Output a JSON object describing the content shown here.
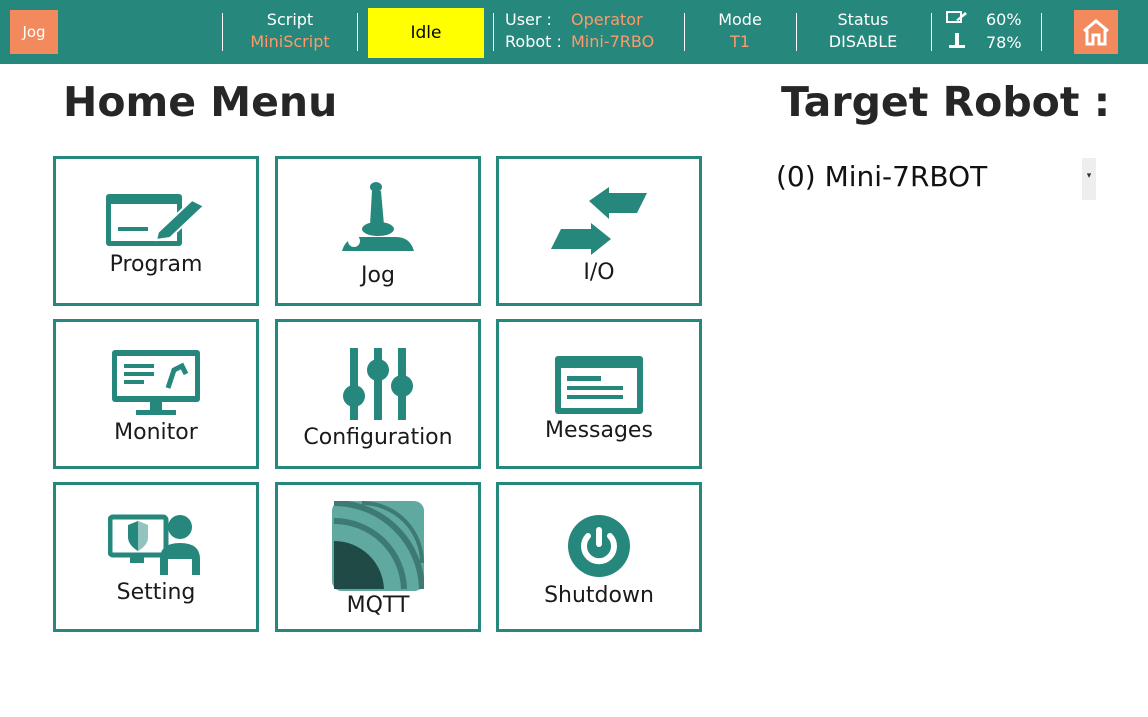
{
  "topbar": {
    "mode_button": "Jog",
    "script_label": "Script",
    "script_value": "MiniScript",
    "state": "Idle",
    "user_label": "User :",
    "user_value": "Operator",
    "robot_label": "Robot :",
    "robot_value": "Mini-7RBO",
    "mode_label": "Mode",
    "mode_value": "T1",
    "status_label": "Status",
    "status_value": "DISABLE",
    "speed_percent": "60%",
    "jog_percent": "78%",
    "home_icon": "home-icon"
  },
  "main": {
    "title": "Home Menu",
    "target_title": "Target Robot :",
    "target_value": "(0) Mini-7RBOT",
    "tiles": [
      {
        "label": "Program",
        "icon": "program-icon"
      },
      {
        "label": "Jog",
        "icon": "joystick-icon"
      },
      {
        "label": "I/O",
        "icon": "io-arrows-icon"
      },
      {
        "label": "Monitor",
        "icon": "monitor-icon"
      },
      {
        "label": "Configuration",
        "icon": "sliders-icon"
      },
      {
        "label": "Messages",
        "icon": "messages-icon"
      },
      {
        "label": "Setting",
        "icon": "user-shield-icon"
      },
      {
        "label": "MQTT",
        "icon": "mqtt-icon"
      },
      {
        "label": "Shutdown",
        "icon": "power-icon"
      }
    ]
  },
  "colors": {
    "accent": "#26877c",
    "orange": "#f28a5e",
    "idle": "#ffff00"
  }
}
